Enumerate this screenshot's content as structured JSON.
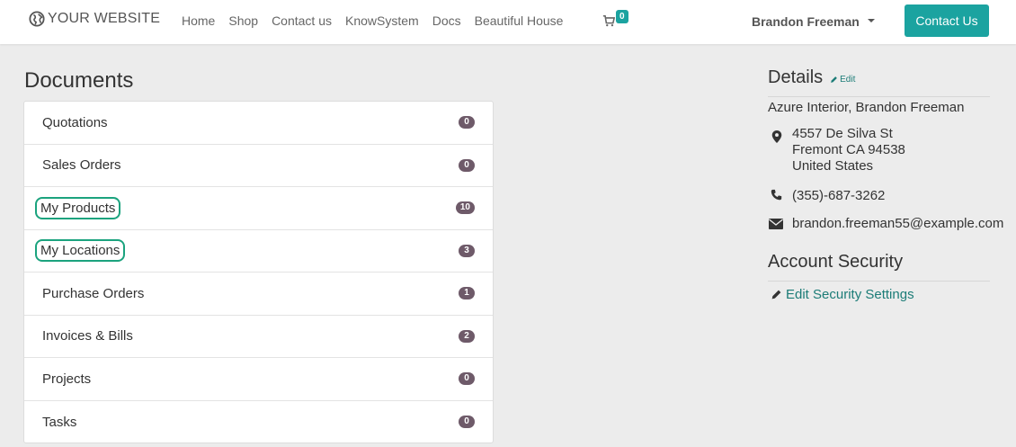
{
  "navbar": {
    "brand": "YOUR WEBSITE",
    "menu": [
      "Home",
      "Shop",
      "Contact us",
      "KnowSystem",
      "Docs",
      "Beautiful House"
    ],
    "cart_count": "0",
    "user_name": "Brandon Freeman",
    "contact_button": "Contact Us"
  },
  "documents": {
    "title": "Documents",
    "items": [
      {
        "label": "Quotations",
        "count": "0"
      },
      {
        "label": "Sales Orders",
        "count": "0"
      },
      {
        "label": "My Products",
        "count": "10"
      },
      {
        "label": "My Locations",
        "count": "3"
      },
      {
        "label": "Purchase Orders",
        "count": "1"
      },
      {
        "label": "Invoices & Bills",
        "count": "2"
      },
      {
        "label": "Projects",
        "count": "0"
      },
      {
        "label": "Tasks",
        "count": "0"
      }
    ]
  },
  "details": {
    "title": "Details",
    "edit_label": "Edit",
    "company": "Azure Interior, Brandon Freeman",
    "address_line1": "4557 De Silva St",
    "address_line2": "Fremont CA 94538",
    "address_line3": "United States",
    "phone": "(355)-687-3262",
    "email": "brandon.freeman55@example.com"
  },
  "security": {
    "title": "Account Security",
    "link": "Edit Security Settings"
  },
  "colors": {
    "accent": "#1ba3a0",
    "badge": "#6e5a69",
    "link": "#1c7c77",
    "highlight_outline": "#1ba37e"
  },
  "icons": [
    "globe-icon",
    "cart-icon",
    "caret-down-icon",
    "pencil-icon",
    "map-marker-icon",
    "phone-icon",
    "envelope-icon"
  ]
}
